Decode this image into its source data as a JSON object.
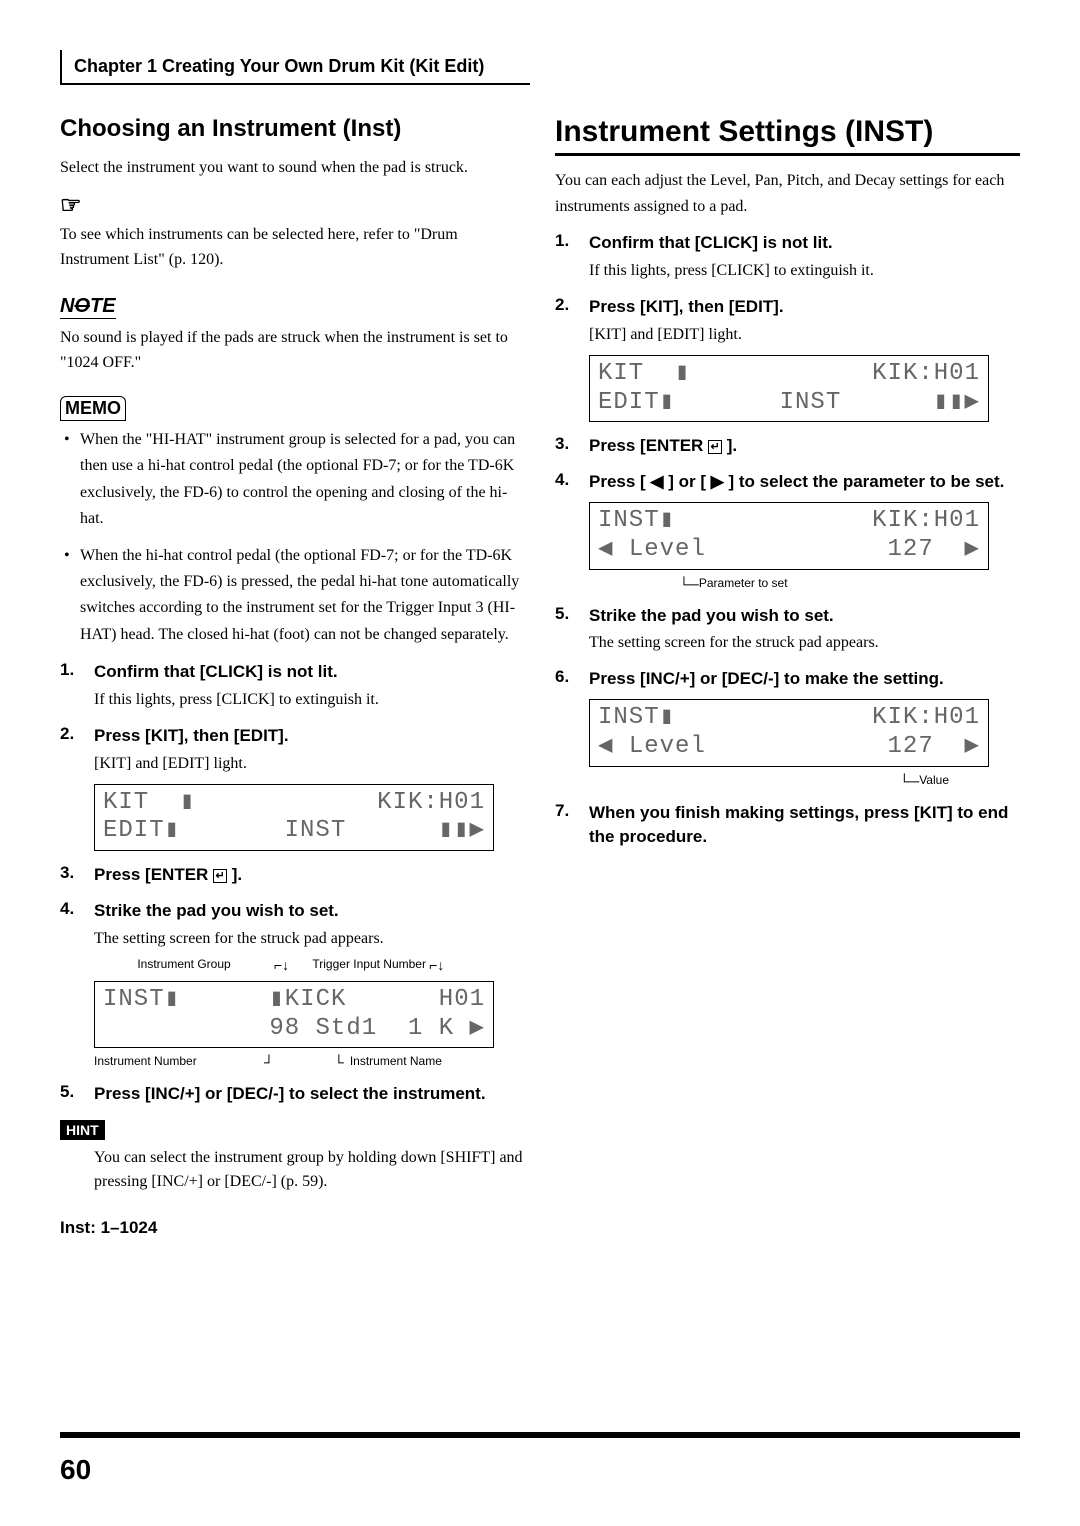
{
  "chapter_header": "Chapter 1 Creating Your Own Drum Kit (Kit Edit)",
  "left": {
    "title": "Choosing an Instrument (Inst)",
    "intro": "Select the instrument you want to sound when the pad is struck.",
    "ref_text": "To see which instruments can be selected here, refer to \"Drum Instrument List\" (p. 120).",
    "note_text": "No sound is played if the pads are struck when the instrument is set to \"1024 OFF.\"",
    "memo_bullets": [
      "When the \"HI-HAT\" instrument group is selected for a pad, you can then use a hi-hat control pedal (the optional FD-7; or for the TD-6K exclusively, the FD-6) to control the opening and closing of the hi-hat.",
      "When the hi-hat control pedal (the optional FD-7; or for the TD-6K exclusively, the FD-6) is pressed, the pedal hi-hat tone automatically switches according to the instrument set for the Trigger Input 3 (HI-HAT) head. The closed hi-hat (foot) can not be changed separately."
    ],
    "steps": [
      {
        "n": "1.",
        "t": "Confirm that [CLICK] is not lit.",
        "b": "If this lights, press [CLICK] to extinguish it."
      },
      {
        "n": "2.",
        "t": "Press [KIT], then [EDIT].",
        "b": "[KIT] and [EDIT] light."
      }
    ],
    "lcd1": {
      "r1a": "KIT  ▮",
      "r1b": "KIK:H01",
      "r2a": "EDIT▮",
      "r2b": "INST      ▮▮▶"
    },
    "step3": {
      "n": "3.",
      "t": "Press [ENTER ⏎ ]."
    },
    "step4": {
      "n": "4.",
      "t": "Strike the pad you wish to set.",
      "b": "The setting screen for the struck pad appears."
    },
    "lcd2_labels": {
      "l1": "Instrument Group",
      "l2": "Trigger Input Number"
    },
    "lcd2": {
      "r1a": "INST▮",
      "r1b": "▮KICK      H01",
      "r2a": "",
      "r2b": "98 Std1  1 K ▶"
    },
    "lcd2_sublabels": {
      "l1": "Instrument Number",
      "l2": "Instrument Name"
    },
    "step5": {
      "n": "5.",
      "t": "Press [INC/+] or [DEC/-] to select the instrument."
    },
    "hint_text": "You can select the instrument group by holding down [SHIFT] and pressing [INC/+] or [DEC/-] (p. 59).",
    "range": "Inst: 1–1024"
  },
  "right": {
    "title": "Instrument Settings (INST)",
    "intro": "You can each adjust the Level, Pan, Pitch, and Decay settings for each instruments assigned to a pad.",
    "steps12": [
      {
        "n": "1.",
        "t": "Confirm that [CLICK] is not lit.",
        "b": "If this lights, press [CLICK] to extinguish it."
      },
      {
        "n": "2.",
        "t": "Press [KIT], then [EDIT].",
        "b": "[KIT] and [EDIT] light."
      }
    ],
    "lcd1": {
      "r1a": "KIT  ▮",
      "r1b": "KIK:H01",
      "r2a": "EDIT▮",
      "r2b": "INST      ▮▮▶"
    },
    "step3": {
      "n": "3.",
      "t": "Press [ENTER ⏎ ]."
    },
    "step4": {
      "n": "4.",
      "t": "Press [ ◀ ] or [ ▶ ] to select the parameter to be set."
    },
    "lcd2": {
      "r1a": "INST▮",
      "r1b": "KIK:H01",
      "r2a": "◀ Level",
      "r2b": "127  ▶"
    },
    "lcd2_annot": "Parameter to set",
    "step5": {
      "n": "5.",
      "t": "Strike the pad you wish to set.",
      "b": "The setting screen for the struck pad appears."
    },
    "step6": {
      "n": "6.",
      "t": "Press [INC/+] or [DEC/-] to make the setting."
    },
    "lcd3": {
      "r1a": "INST▮",
      "r1b": "KIK:H01",
      "r2a": "◀ Level",
      "r2b": "127  ▶"
    },
    "lcd3_annot": "Value",
    "step7": {
      "n": "7.",
      "t": "When you finish making settings, press [KIT] to end the procedure."
    }
  },
  "page_num": "60"
}
